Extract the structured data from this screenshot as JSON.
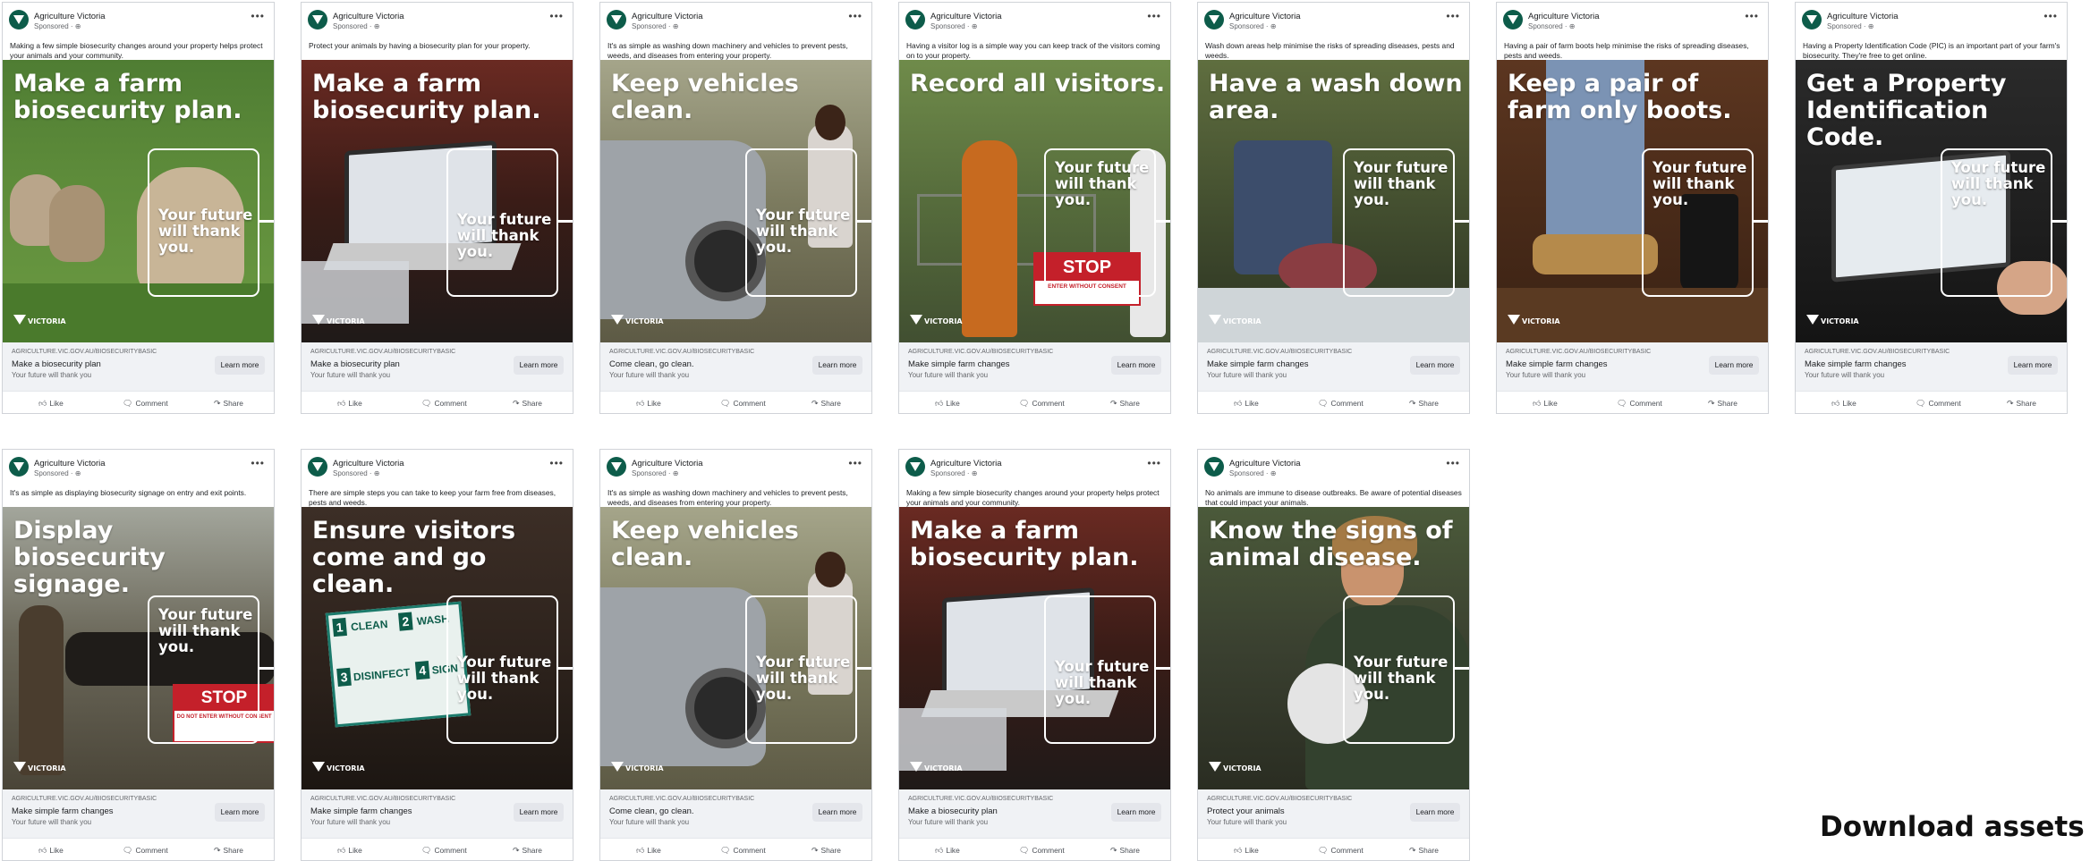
{
  "colors": {
    "brand_green": "#0d5c4a",
    "button_bg": "#e4e6eb",
    "footer_bg": "#f0f2f5"
  },
  "common": {
    "page_name": "Agriculture Victoria",
    "sponsored": "Sponsored · ⊕",
    "more_icon": "more-dots-icon",
    "future_text": "Your future will thank you.",
    "url": "AGRICULTURE.VIC.GOV.AU/BIOSECURITYBASIC",
    "learn_more": "Learn more",
    "cta_sub": "Your future will thank you",
    "like": "Like",
    "comment": "Comment",
    "share": "Share",
    "logo_text": "VICTORIA"
  },
  "posts": [
    {
      "caption": "Making a few simple biosecurity changes around your property helps protect your animals and your community.",
      "headline": "Make a farm biosecurity plan.",
      "cta_title": "Make a biosecurity plan",
      "scene": "sheep"
    },
    {
      "caption": "Protect your animals by having a biosecurity plan for your property.",
      "headline": "Make a farm biosecurity plan.",
      "cta_title": "Make a biosecurity plan",
      "scene": "laptop"
    },
    {
      "caption": "It's as simple as washing down machinery and vehicles to prevent pests, weeds, and diseases from entering your property.",
      "headline": "Keep vehicles clean.",
      "cta_title": "Come clean, go clean.",
      "scene": "vehicle"
    },
    {
      "caption": "Having a visitor log is a simple way you can keep track of the visitors coming on to your property.",
      "headline": "Record all visitors.",
      "cta_title": "Make simple farm changes",
      "scene": "visitors"
    },
    {
      "caption": "Wash down areas help minimise the risks of spreading diseases, pests and weeds.",
      "headline": "Have a wash down area.",
      "cta_title": "Make simple farm changes",
      "scene": "wash"
    },
    {
      "caption": "Having a pair of farm boots help minimise the risks of spreading diseases, pests and weeds.",
      "headline": "Keep a pair of farm only boots.",
      "cta_title": "Make simple farm changes",
      "scene": "boots"
    },
    {
      "caption": "Having a Property Identification Code (PIC) is an important part of your farm's biosecurity. They're free to get online.",
      "headline": "Get a Property Identification Code.",
      "cta_title": "Make simple farm changes",
      "scene": "pic"
    },
    {
      "caption": "It's as simple as displaying biosecurity signage on entry and exit points.",
      "headline": "Display biosecurity signage.",
      "cta_title": "Make simple farm changes",
      "scene": "signage"
    },
    {
      "caption": "There are simple steps you can take to keep your farm free from diseases, pests and weeds.",
      "headline": "Ensure visitors come and go clean.",
      "cta_title": "Make simple farm changes",
      "scene": "clean-sign"
    },
    {
      "caption": "It's as simple as washing down machinery and vehicles to prevent pests, weeds, and diseases from entering your property.",
      "headline": "Keep vehicles clean.",
      "cta_title": "Come clean, go clean.",
      "scene": "vehicle"
    },
    {
      "caption": "Making a few simple biosecurity changes around your property helps protect your animals and your community.",
      "headline": "Make a farm biosecurity plan.",
      "cta_title": "Make a biosecurity plan",
      "scene": "laptop"
    },
    {
      "caption": "No animals are immune to disease outbreaks. Be aware of potential diseases that could impact your animals.",
      "headline": "Know the signs of animal disease.",
      "cta_title": "Protect your animals",
      "scene": "chicken"
    }
  ],
  "scene_text": {
    "stop": "STOP",
    "stop_sub": "ENTER WITHOUT CONSENT",
    "stop_sub2": "DO NOT ENTER WITHOUT CONSENT",
    "clean": "CLEAN",
    "wash": "WASH",
    "disinfect": "DISINFECT",
    "sign": "SIGN",
    "n1": "1",
    "n2": "2",
    "n3": "3",
    "n4": "4"
  },
  "download": "Download assets"
}
